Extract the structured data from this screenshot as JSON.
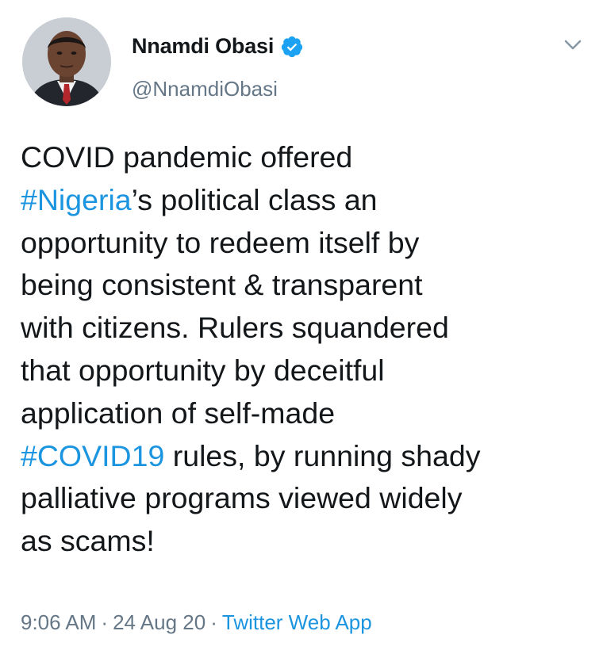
{
  "author": {
    "display_name": "Nnamdi Obasi",
    "handle": "@NnamdiObasi",
    "verified": true
  },
  "icons": {
    "verified": "verified-badge-icon",
    "menu": "chevron-down-icon"
  },
  "tweet": {
    "lines": [
      [
        {
          "text": "COVID pandemic offered",
          "type": "text"
        }
      ],
      [
        {
          "text": "#Nigeria",
          "type": "hashtag"
        },
        {
          "text": "’s political class an",
          "type": "text"
        }
      ],
      [
        {
          "text": "opportunity to redeem itself by",
          "type": "text"
        }
      ],
      [
        {
          "text": "being consistent & transparent",
          "type": "text"
        }
      ],
      [
        {
          "text": "with citizens. Rulers squandered",
          "type": "text"
        }
      ],
      [
        {
          "text": "that opportunity by deceitful",
          "type": "text"
        }
      ],
      [
        {
          "text": "application of self-made",
          "type": "text"
        }
      ],
      [
        {
          "text": "#COVID19",
          "type": "hashtag"
        },
        {
          "text": " rules, by running shady",
          "type": "text"
        }
      ],
      [
        {
          "text": "palliative programs viewed widely",
          "type": "text"
        }
      ],
      [
        {
          "text": "as scams!",
          "type": "text"
        }
      ]
    ],
    "time": "9:06 AM",
    "date": "24 Aug 20",
    "separator": "·",
    "source": "Twitter Web App"
  },
  "colors": {
    "link": "#1b95e0",
    "muted": "#657786",
    "text": "#14171a",
    "verified": "#1da1f2"
  }
}
